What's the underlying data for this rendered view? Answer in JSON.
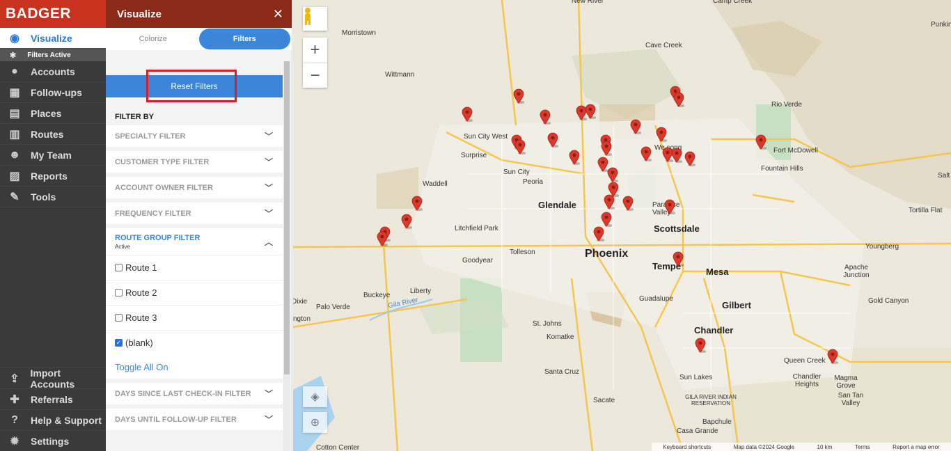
{
  "app": {
    "logo": "BADGER"
  },
  "nav": {
    "items": [
      {
        "label": "Visualize",
        "icon": "eye-icon",
        "glyph": "◉"
      },
      {
        "label": "Accounts",
        "icon": "person-icon",
        "glyph": "●"
      },
      {
        "label": "Follow-ups",
        "icon": "calendar-icon",
        "glyph": "▦"
      },
      {
        "label": "Places",
        "icon": "store-icon",
        "glyph": "▤"
      },
      {
        "label": "Routes",
        "icon": "map-icon",
        "glyph": "▥"
      },
      {
        "label": "My Team",
        "icon": "team-icon",
        "glyph": "☻"
      },
      {
        "label": "Reports",
        "icon": "chart-icon",
        "glyph": "▨"
      },
      {
        "label": "Tools",
        "icon": "wrench-icon",
        "glyph": "✎"
      }
    ],
    "filters_active": "Filters Active",
    "bottom": [
      {
        "label": "Import Accounts",
        "icon": "upload-icon",
        "glyph": "⇪"
      },
      {
        "label": "Referrals",
        "icon": "gift-icon",
        "glyph": "✚"
      },
      {
        "label": "Help & Support",
        "icon": "help-icon",
        "glyph": "?"
      },
      {
        "label": "Settings",
        "icon": "gear-icon",
        "glyph": "✹"
      }
    ]
  },
  "panel": {
    "title": "Visualize",
    "close": "✕",
    "tabs": [
      "Colorize",
      "Filters"
    ],
    "reset": "Reset Filters",
    "filter_by": "FILTER BY",
    "filters_top": [
      "SPECIALTY FILTER",
      "CUSTOMER TYPE FILTER",
      "ACCOUNT OWNER FILTER",
      "FREQUENCY FILTER"
    ],
    "route_group": {
      "title": "ROUTE GROUP FILTER",
      "status": "Active"
    },
    "routes": [
      {
        "label": "Route 1",
        "checked": false
      },
      {
        "label": "Route 2",
        "checked": false
      },
      {
        "label": "Route 3",
        "checked": false
      },
      {
        "label": "(blank)",
        "checked": true
      }
    ],
    "toggle_all": "Toggle All On",
    "filters_bottom": [
      "DAYS SINCE LAST CHECK-IN FILTER",
      "DAYS UNTIL FOLLOW-UP FILTER"
    ]
  },
  "map": {
    "labels": {
      "phoenix": "Phoenix",
      "glendale": "Glendale",
      "scottsdale": "Scottsdale",
      "mesa": "Mesa",
      "tempe": "Tempe",
      "chandler": "Chandler",
      "gilbert": "Gilbert",
      "peoria": "Peoria",
      "sun_city": "Sun City",
      "sun_city_west": "Sun City West",
      "surprise": "Surprise",
      "waddell": "Waddell",
      "litchfield": "Litchfield Park",
      "goodyear": "Goodyear",
      "tolleson": "Tolleson",
      "buckeye": "Buckeye",
      "liberty": "Liberty",
      "palo_verde": "Palo Verde",
      "wittmann": "Wittmann",
      "morristown": "Morristown",
      "cave_creek": "Cave Creek",
      "rio_verde": "Rio Verde",
      "fort_mcdowell": "Fort McDowell",
      "fountain_hills": "Fountain Hills",
      "paradise_valley": "Paradise Valley",
      "guadalupe": "Guadalupe",
      "komatke": "Komatke",
      "st_johns": "St. Johns",
      "santa_cruz": "Santa Cruz",
      "sacate": "Sacate",
      "sun_lakes": "Sun Lakes",
      "queen_creek": "Queen Creek",
      "chandler_heights": "Chandler Heights",
      "magma_grove": "Magma Grove",
      "san_tan_valley": "San Tan Valley",
      "gold_canyon": "Gold Canyon",
      "apache_junction": "Apache Junction",
      "youngberg": "Youngberg",
      "tortilla_flat": "Tortilla Flat",
      "gila_river": "Gila River",
      "gila_res": "GILA RIVER INDIAN RESERVATION",
      "bapchule": "Bapchule",
      "casa_grande": "Casa Grande",
      "cotton_center": "Cotton Center",
      "dixie": "Dixie",
      "arlington": "ngton",
      "new_river": "New River",
      "camp_creek": "Camp Creek",
      "punkin": "Punkin",
      "salt": "Salt",
      "wetsong": "We song"
    },
    "footer": {
      "shortcuts": "Keyboard shortcuts",
      "data": "Map data ©2024 Google",
      "scale": "10 km",
      "terms": "Terms",
      "report": "Report a map error"
    },
    "zoom_in": "+",
    "zoom_out": "−",
    "pin_color": "#d93a2b"
  }
}
